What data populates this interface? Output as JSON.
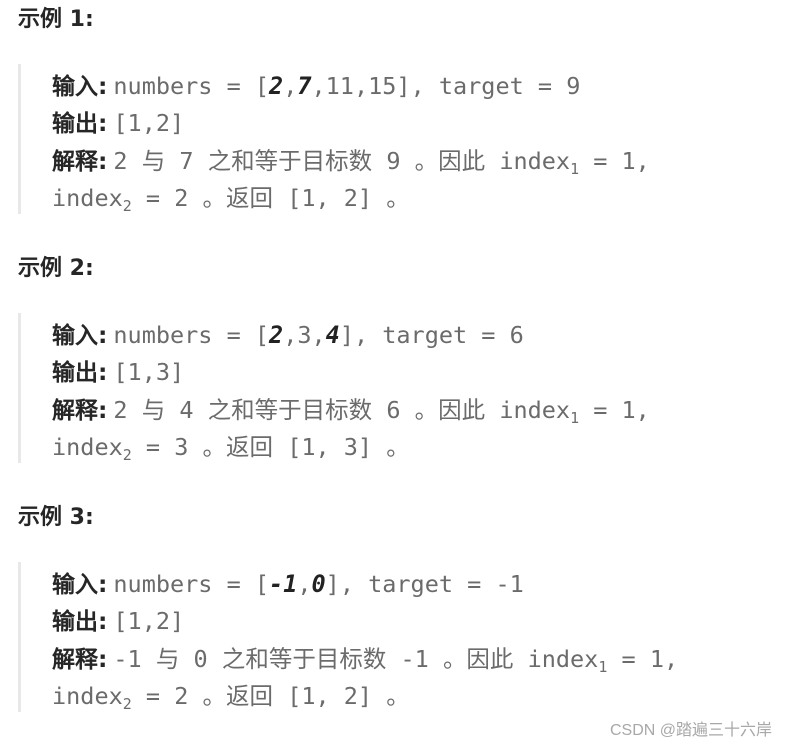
{
  "examples": [
    {
      "title": "示例 1:",
      "input_label": "输入",
      "input_prefix": "numbers = [",
      "input_array": [
        {
          "text": "2",
          "emphasis": true
        },
        {
          "text": ",",
          "emphasis": false
        },
        {
          "text": "7",
          "emphasis": true
        },
        {
          "text": ",11,15]",
          "emphasis": false
        }
      ],
      "input_suffix": ", target = 9",
      "output_label": "输出",
      "output_value": "[1,2]",
      "explanation_label": "解释",
      "explanation_a": "2",
      "explanation_with": "与",
      "explanation_b": "7",
      "explanation_mid": "之和等于目标数",
      "explanation_target": "9",
      "explanation_so": "。因此",
      "index1_name": "index",
      "index1_sub": "1",
      "index1_value": " = 1,",
      "index2_name": "index",
      "index2_sub": "2",
      "index2_value": " = 2",
      "return_text": "。返回",
      "return_value": "[1, 2]",
      "end": "。"
    },
    {
      "title": "示例 2:",
      "input_label": "输入",
      "input_prefix": "numbers = [",
      "input_array": [
        {
          "text": "2",
          "emphasis": true
        },
        {
          "text": ",3,",
          "emphasis": false
        },
        {
          "text": "4",
          "emphasis": true
        },
        {
          "text": "]",
          "emphasis": false
        }
      ],
      "input_suffix": ", target = 6",
      "output_label": "输出",
      "output_value": "[1,3]",
      "explanation_label": "解释",
      "explanation_a": "2",
      "explanation_with": "与",
      "explanation_b": "4",
      "explanation_mid": "之和等于目标数",
      "explanation_target": "6",
      "explanation_so": "。因此",
      "index1_name": "index",
      "index1_sub": "1",
      "index1_value": " = 1,",
      "index2_name": "index",
      "index2_sub": "2",
      "index2_value": " = 3",
      "return_text": "。返回",
      "return_value": "[1, 3]",
      "end": "。"
    },
    {
      "title": "示例 3:",
      "input_label": "输入",
      "input_prefix": "numbers = [",
      "input_array": [
        {
          "text": "-1",
          "emphasis": true
        },
        {
          "text": ",",
          "emphasis": false
        },
        {
          "text": "0",
          "emphasis": true
        },
        {
          "text": "]",
          "emphasis": false
        }
      ],
      "input_suffix": ", target = -1",
      "output_label": "输出",
      "output_value": "[1,2]",
      "explanation_label": "解释",
      "explanation_a": "-1",
      "explanation_with": "与",
      "explanation_b": "0",
      "explanation_mid": "之和等于目标数",
      "explanation_target": "-1",
      "explanation_so": "。因此",
      "index1_name": "index",
      "index1_sub": "1",
      "index1_value": " = 1,",
      "index2_name": "index",
      "index2_sub": "2",
      "index2_value": " = 2",
      "return_text": "。返回",
      "return_value": "[1, 2]",
      "end": "。"
    }
  ],
  "colon": ":",
  "watermark": "CSDN @踏遍三十六岸"
}
